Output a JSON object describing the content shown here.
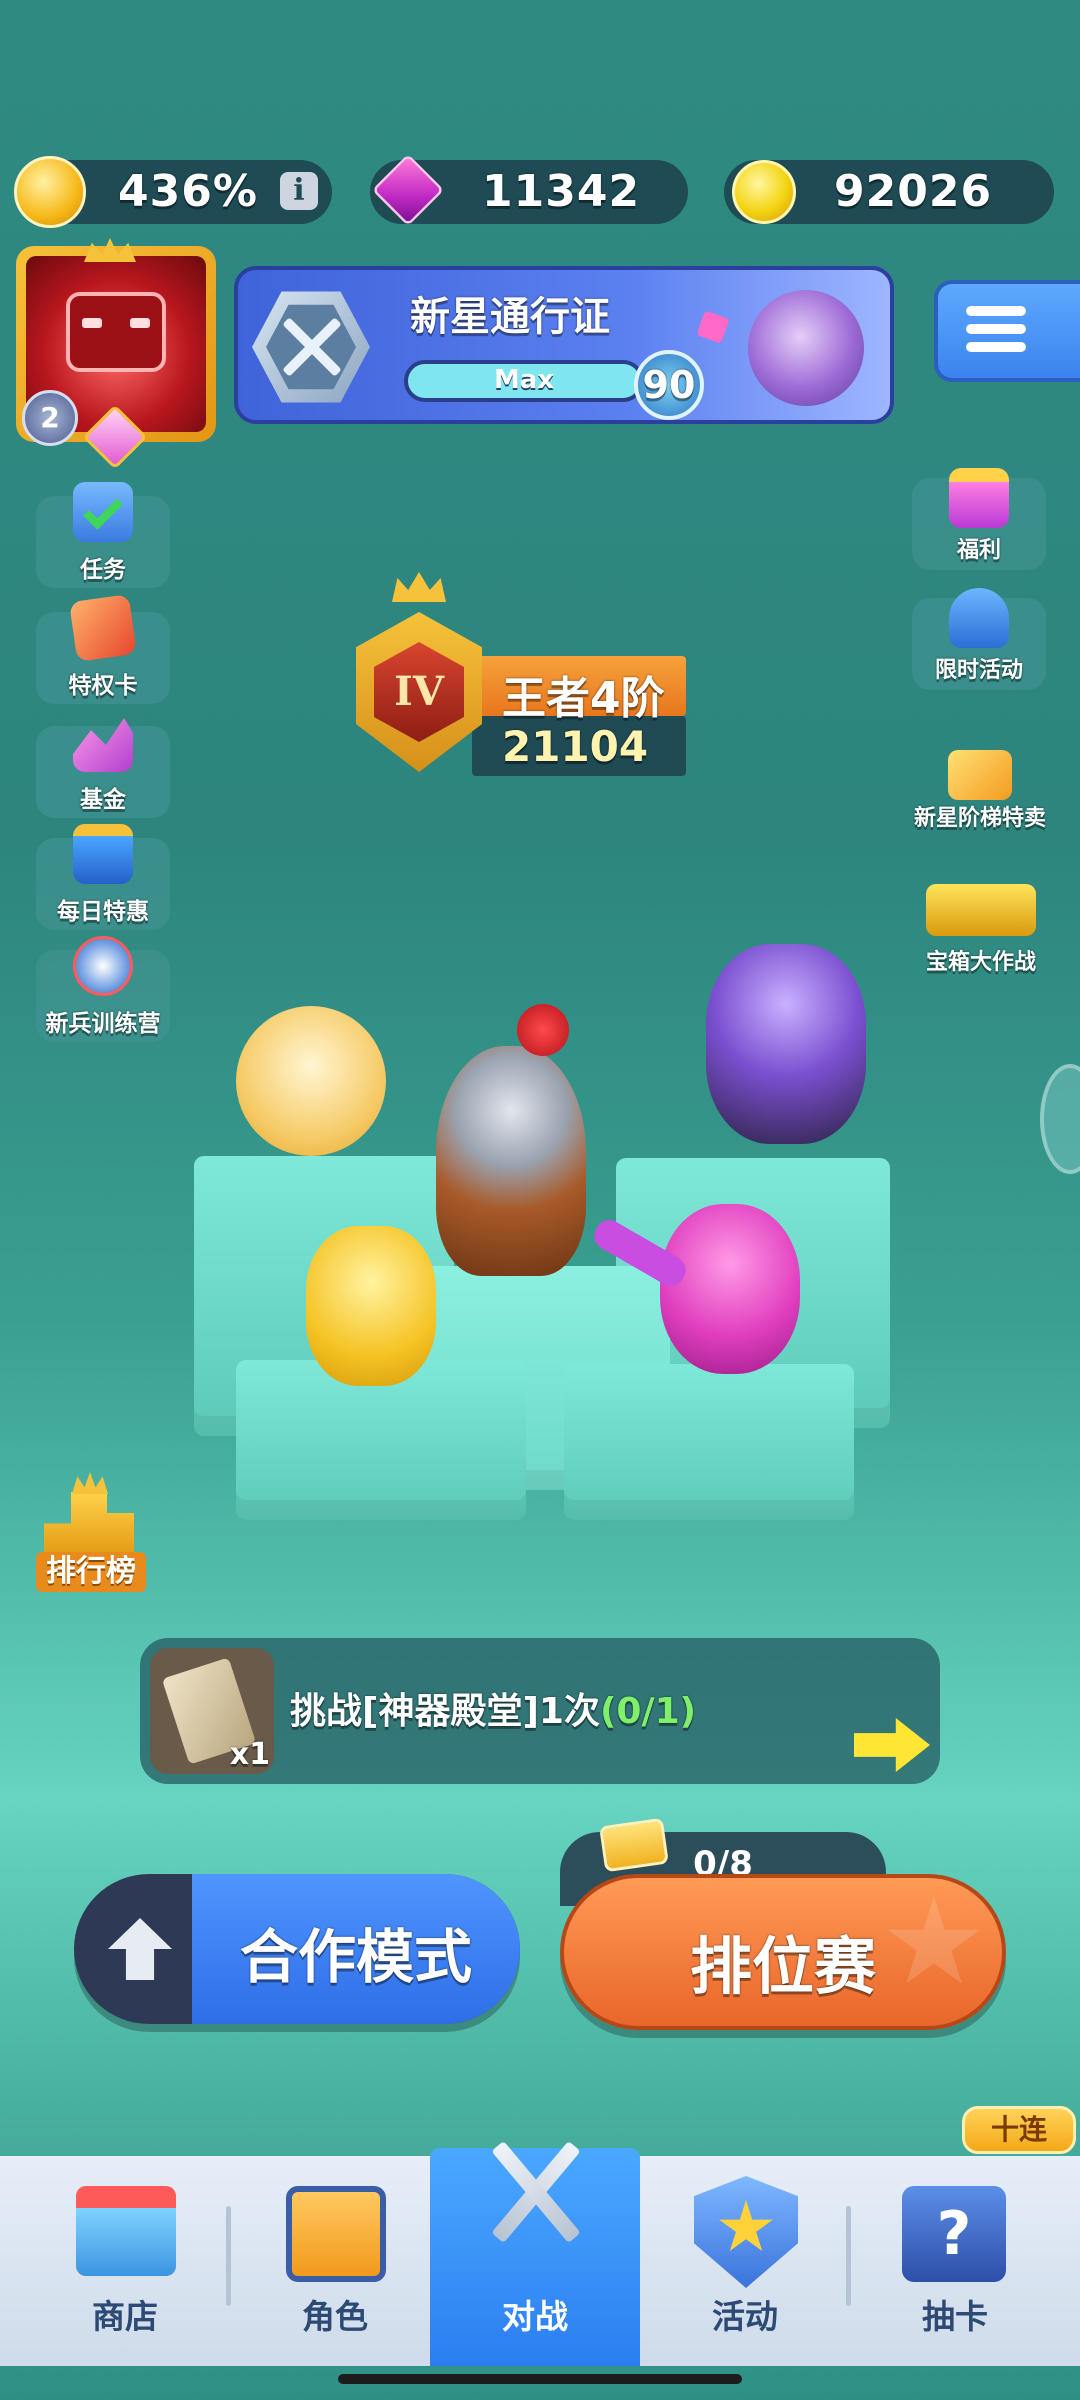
{
  "resources": {
    "trophy_percent": "436%",
    "gems": "11342",
    "coins": "92026"
  },
  "profile": {
    "level": "2"
  },
  "pass": {
    "title": "新星通行证",
    "progress_label": "Max",
    "level": "90"
  },
  "left_menu": [
    {
      "label": "任务",
      "icon": "clipboard-check-icon"
    },
    {
      "label": "特权卡",
      "icon": "vip-card-icon"
    },
    {
      "label": "基金",
      "icon": "fund-chart-icon"
    },
    {
      "label": "每日特惠",
      "icon": "daily-deal-icon"
    },
    {
      "label": "新兵训练营",
      "icon": "medal-icon"
    }
  ],
  "right_menu": [
    {
      "label": "福利",
      "icon": "gift-icon"
    },
    {
      "label": "限时活动",
      "icon": "clock-icon"
    },
    {
      "label": "新星阶梯特卖",
      "icon": "ladder-sale-icon"
    },
    {
      "label": "宝箱大作战",
      "icon": "treasure-chest-icon"
    }
  ],
  "rank": {
    "badge": "IV",
    "title": "王者4阶",
    "score": "21104"
  },
  "leaderboard": {
    "label": "排行榜"
  },
  "challenge": {
    "text": "挑战[神器殿堂]1次",
    "progress": "(0/1)",
    "reward_count": "x1"
  },
  "tickets": {
    "count": "0/8"
  },
  "modes": {
    "coop": "合作模式",
    "ranked": "排位赛"
  },
  "nav": {
    "items": [
      {
        "label": "商店"
      },
      {
        "label": "角色"
      },
      {
        "label": "对战"
      },
      {
        "label": "活动"
      },
      {
        "label": "抽卡"
      }
    ],
    "badge": "十连"
  },
  "colors": {
    "accent_blue": "#3f7ff0",
    "accent_orange": "#ef7a3c",
    "progress_green": "#7ef06a"
  }
}
